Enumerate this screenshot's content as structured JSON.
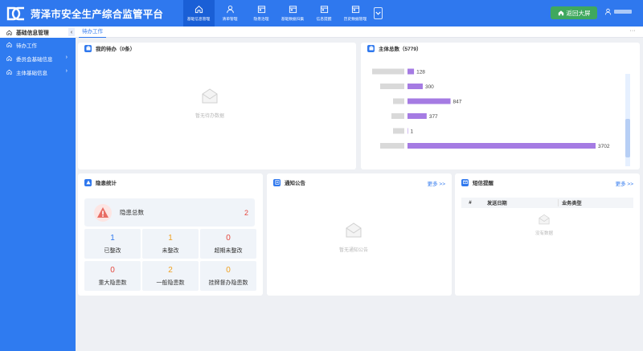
{
  "header": {
    "title": "菏泽市安全生产综合监管平台",
    "nav": [
      {
        "label": "基础信息管理",
        "icon": "home-icon",
        "active": true
      },
      {
        "label": "清单管理",
        "icon": "user-icon",
        "active": false
      },
      {
        "label": "隐患治理",
        "icon": "calendar-icon",
        "active": false
      },
      {
        "label": "基础数据归集",
        "icon": "calendar-icon",
        "active": false
      },
      {
        "label": "信息提醒",
        "icon": "calendar-icon",
        "active": false
      },
      {
        "label": "历史数据管理",
        "icon": "calendar-icon",
        "active": false
      }
    ],
    "return_label": "返回大屏",
    "user_name": "用户"
  },
  "sidebar": {
    "title": "基础信息管理",
    "items": [
      {
        "label": "待办工作",
        "expandable": false
      },
      {
        "label": "委员会基础信息",
        "expandable": true
      },
      {
        "label": "主体基础信息",
        "expandable": true
      }
    ]
  },
  "tabs": {
    "active": "待办工作"
  },
  "todo": {
    "title": "我的待办（0条）",
    "empty": "暂无待办数据"
  },
  "subjects": {
    "title": "主体总数（5779）"
  },
  "chart_data": {
    "type": "bar",
    "orientation": "horizontal",
    "categories": [
      "",
      "",
      "",
      "",
      "",
      ""
    ],
    "values": [
      128,
      300,
      847,
      377,
      1,
      3702
    ],
    "xlim": [
      0,
      3702
    ]
  },
  "hazard": {
    "title": "隐患统计",
    "total_label": "隐患总数",
    "total_value": "2",
    "cells": [
      {
        "value": "1",
        "label": "已整改",
        "color": "#2f78ee"
      },
      {
        "value": "1",
        "label": "未整改",
        "color": "#f0a020"
      },
      {
        "value": "0",
        "label": "超期未整改",
        "color": "#e5473e"
      },
      {
        "value": "0",
        "label": "重大隐患数",
        "color": "#e5473e"
      },
      {
        "value": "2",
        "label": "一般隐患数",
        "color": "#f0a020"
      },
      {
        "value": "0",
        "label": "挂牌督办隐患数",
        "color": "#f0a020"
      }
    ]
  },
  "notice": {
    "title": "通知公告",
    "more": "更多 >>",
    "empty": "暂无通知公告"
  },
  "sms": {
    "title": "短信提醒",
    "more": "更多 >>",
    "col_index": "#",
    "col_date": "发送日期",
    "col_type": "业务类型",
    "empty": "没有数据"
  },
  "colors": {
    "brand": "#2f78ee",
    "bar": "#a57be3",
    "return_button": "#3fa85e"
  }
}
